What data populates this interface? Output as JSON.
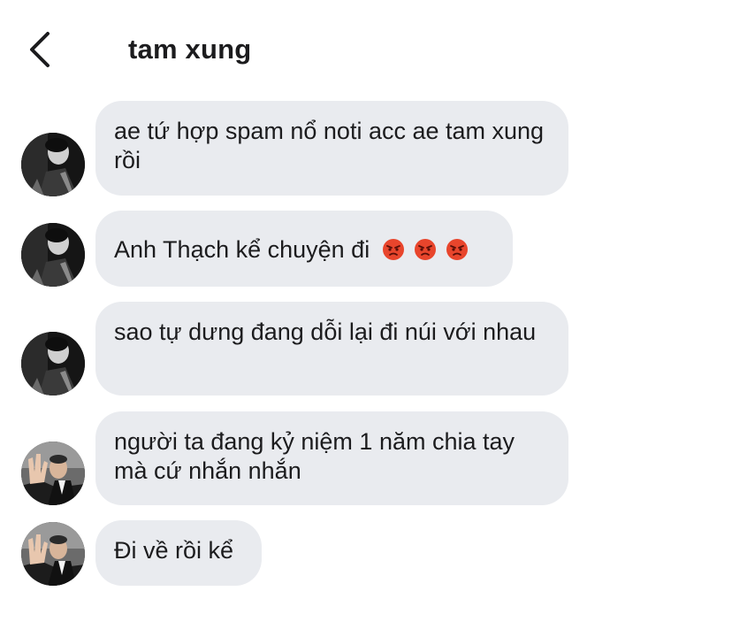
{
  "header": {
    "back_icon": "chevron-left-icon",
    "title": "tam xung"
  },
  "colors": {
    "bubble_bg": "#e9ebef",
    "text": "#1c1c1e",
    "angry_emoji": "#e8452c"
  },
  "messages": [
    {
      "avatar": "avatar-user-a",
      "text": "ae tứ hợp spam nổ noti acc ae tam xung rồi"
    },
    {
      "avatar": "avatar-user-a",
      "text": "Anh Thạch kể chuyện đi",
      "emojis": [
        "angry-face-icon",
        "angry-face-icon",
        "angry-face-icon"
      ]
    },
    {
      "avatar": "avatar-user-a",
      "text": "sao tự dưng đang dỗi lại đi núi với nhau"
    },
    {
      "avatar": "avatar-user-b",
      "text": "người ta đang kỷ niệm 1 năm chia tay mà cứ nhắn nhắn"
    },
    {
      "avatar": "avatar-user-b",
      "text": "Đi về rồi kể"
    }
  ]
}
